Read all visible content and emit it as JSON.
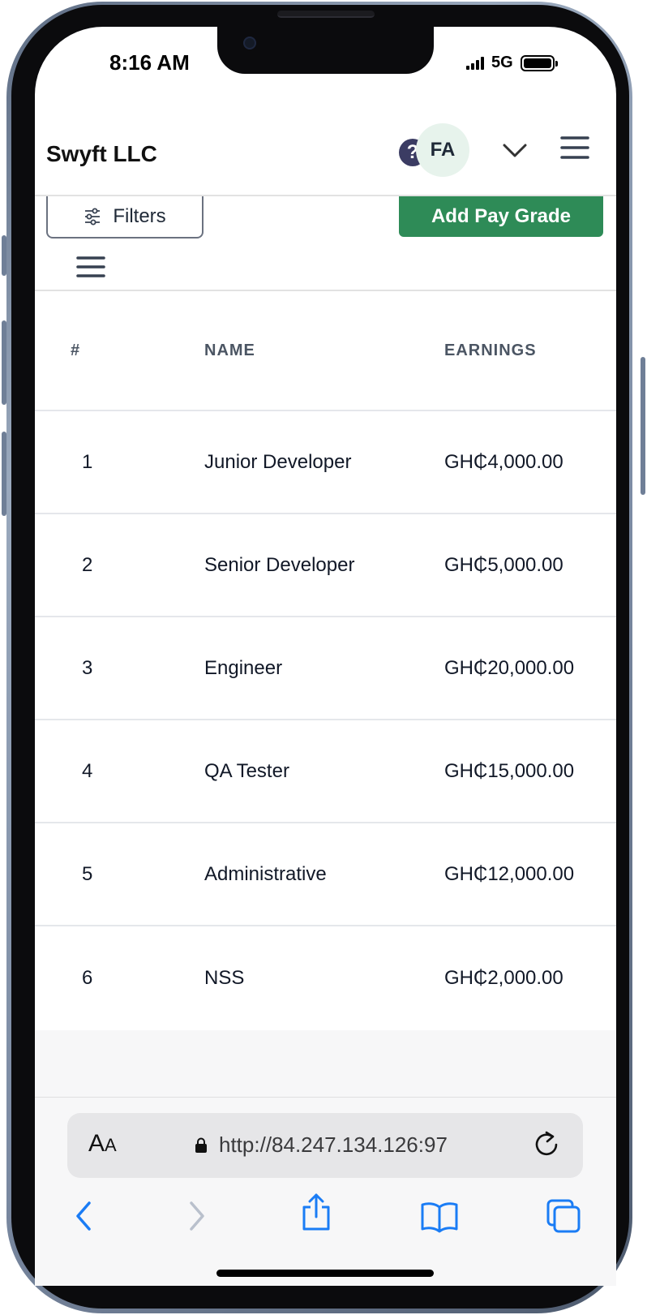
{
  "status_bar": {
    "time": "8:16 AM",
    "network": "5G"
  },
  "header": {
    "brand": "Swyft LLC",
    "help_icon": "question-circle-icon",
    "avatar_initials": "FA",
    "dropdown_icon": "chevron-down-icon",
    "menu_icon": "hamburger-menu-icon"
  },
  "toolbar": {
    "filters_label": "Filters",
    "filters_icon": "sliders-icon",
    "add_label": "Add Pay Grade",
    "add_color": "#2e8b57",
    "table_menu_icon": "hamburger-menu-icon"
  },
  "table": {
    "columns": [
      "#",
      "NAME",
      "EARNINGS"
    ],
    "rows": [
      {
        "num": "1",
        "name": "Junior Developer",
        "earnings": "GH₵4,000.00"
      },
      {
        "num": "2",
        "name": "Senior Developer",
        "earnings": "GH₵5,000.00"
      },
      {
        "num": "3",
        "name": "Engineer",
        "earnings": "GH₵20,000.00"
      },
      {
        "num": "4",
        "name": "QA Tester",
        "earnings": "GH₵15,000.00"
      },
      {
        "num": "5",
        "name": "Administrative",
        "earnings": "GH₵12,000.00"
      },
      {
        "num": "6",
        "name": "NSS",
        "earnings": "GH₵2,000.00"
      }
    ]
  },
  "browser": {
    "text_size_label": "AA",
    "url": "http://84.247.134.126:97",
    "accent": "#1a7cf5",
    "icons": [
      "back-icon",
      "forward-icon",
      "share-icon",
      "bookmarks-icon",
      "tabs-icon",
      "reload-icon",
      "lock-icon"
    ]
  }
}
